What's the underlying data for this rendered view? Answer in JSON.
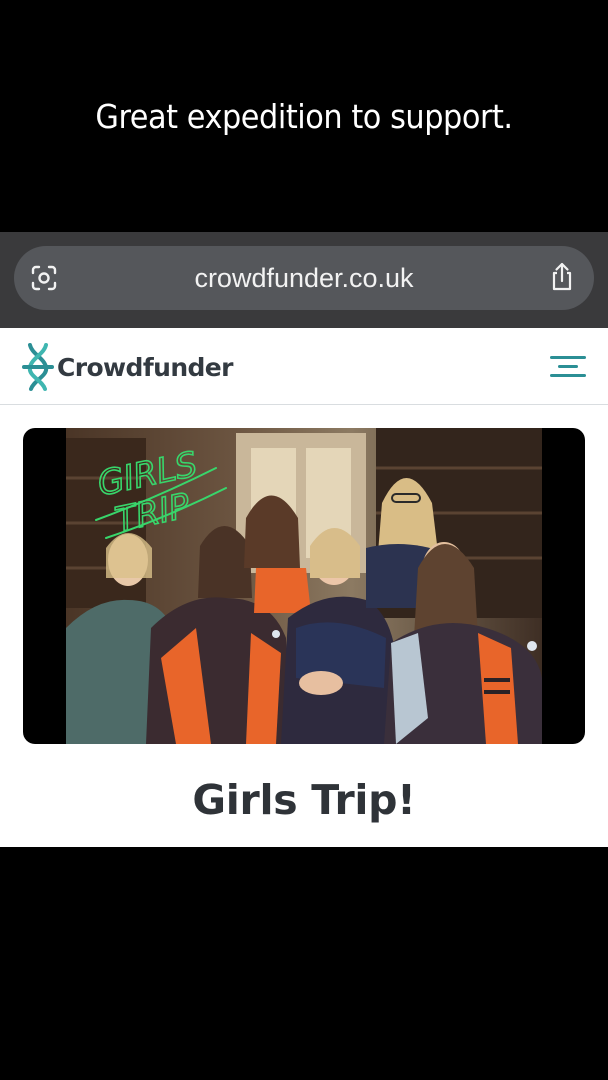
{
  "caption": "Great expedition to support.",
  "browser": {
    "url": "crowdfunder.co.uk",
    "left_icon": "camera-scan-icon",
    "right_icon": "share-icon"
  },
  "site": {
    "logo_text": "Crowdfunder",
    "logo_icon": "crowdfunder-logo-icon",
    "menu_icon": "hamburger-menu-icon",
    "brand_color": "#2b8f95"
  },
  "campaign": {
    "title": "Girls Trip!",
    "image_overlay_text": "GIRLS TRIP"
  }
}
